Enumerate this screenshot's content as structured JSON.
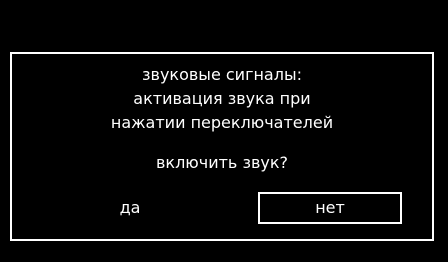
{
  "dialog": {
    "message_lines": [
      "звуковые сигналы:",
      "активация звука при",
      "нажатии переключателей"
    ],
    "question": "включить звук?",
    "options": {
      "yes_label": "да",
      "no_label": "нет",
      "selected": "нет"
    }
  },
  "colors": {
    "background": "#000000",
    "foreground": "#ffffff"
  }
}
